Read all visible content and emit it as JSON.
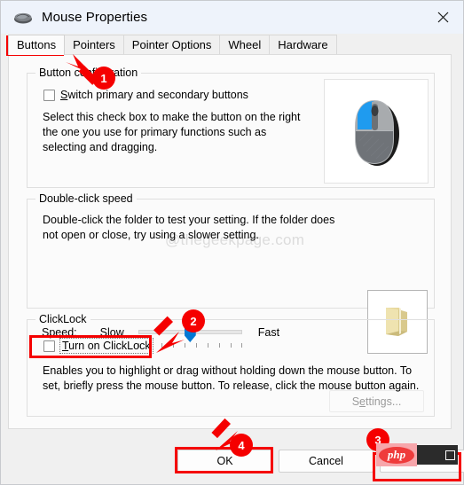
{
  "window": {
    "title": "Mouse Properties",
    "title_icon": "mouse-icon",
    "close_icon": "close-icon"
  },
  "tabs": [
    {
      "label": "Buttons",
      "active": true
    },
    {
      "label": "Pointers",
      "active": false
    },
    {
      "label": "Pointer Options",
      "active": false
    },
    {
      "label": "Wheel",
      "active": false
    },
    {
      "label": "Hardware",
      "active": false
    }
  ],
  "button_configuration": {
    "group_title": "Button configuration",
    "checkbox_label_prefix": "S",
    "checkbox_label_rest": "witch primary and secondary buttons",
    "checkbox_checked": false,
    "description": "Select this check box to make the button on the right the one you use for primary functions such as selecting and dragging.",
    "preview_icon": "mouse-preview-icon"
  },
  "double_click_speed": {
    "group_title": "Double-click speed",
    "description": "Double-click the folder to test your setting. If the folder does not open or close, try using a slower setting.",
    "speed_label_prefix": "Spee",
    "speed_label_underlined": "d",
    "speed_label_suffix": ":",
    "slow_label": "Slow",
    "fast_label": "Fast",
    "slider_value": 45,
    "slider_min": 0,
    "slider_max": 100,
    "folder_icon": "folder-preview-icon"
  },
  "clicklock": {
    "group_title": "ClickLock",
    "checkbox_label_prefix": "T",
    "checkbox_label_rest": "urn on ClickLock",
    "checkbox_checked": false,
    "settings_label_prefix": "S",
    "settings_label_underlined": "e",
    "settings_label_suffix": "ttings...",
    "settings_disabled": true,
    "description": "Enables you to highlight or drag without holding down the mouse button. To set, briefly press the mouse button. To release, click the mouse button again."
  },
  "footer": {
    "ok_label": "OK",
    "cancel_label": "Cancel",
    "apply_label": ""
  },
  "watermark": {
    "text": "@thegeekpage.com"
  },
  "php_logo": {
    "text": "php"
  },
  "annotations": {
    "accent_color": "#f50000",
    "badges": [
      {
        "id": "1",
        "label": "1"
      },
      {
        "id": "2",
        "label": "2"
      },
      {
        "id": "3",
        "label": "3"
      },
      {
        "id": "4",
        "label": "4"
      }
    ],
    "highlight_boxes": [
      {
        "target": "tab-buttons"
      },
      {
        "target": "clicklock-checkbox"
      },
      {
        "target": "ok-button"
      },
      {
        "target": "php-logo"
      }
    ]
  }
}
